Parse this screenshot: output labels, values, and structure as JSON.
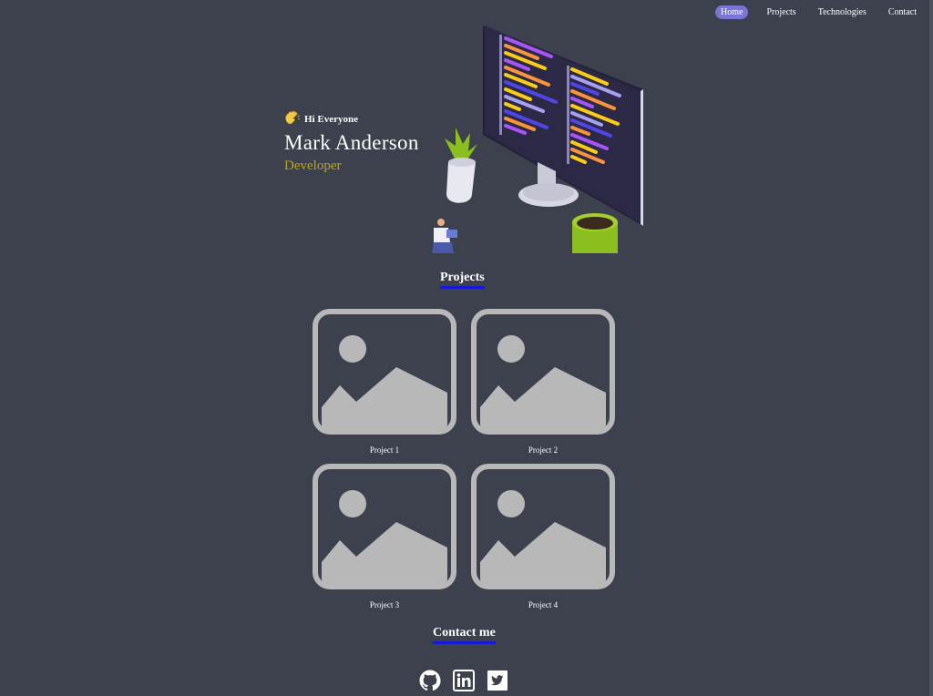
{
  "nav": {
    "items": [
      {
        "label": "Home",
        "active": true
      },
      {
        "label": "Projects",
        "active": false
      },
      {
        "label": "Technologies",
        "active": false
      },
      {
        "label": "Contact",
        "active": false
      }
    ]
  },
  "hero": {
    "greeting_icon": "waving-hand-icon",
    "greeting": "Hi Everyone",
    "name": "Mark Anderson",
    "role": "Developer"
  },
  "projects": {
    "title": "Projects",
    "items": [
      {
        "label": "Project 1",
        "icon": "image-placeholder-icon"
      },
      {
        "label": "Project 2",
        "icon": "image-placeholder-icon"
      },
      {
        "label": "Project 3",
        "icon": "image-placeholder-icon"
      },
      {
        "label": "Project 4",
        "icon": "image-placeholder-icon"
      }
    ]
  },
  "contact": {
    "title": "Contact me",
    "socials": [
      {
        "icon": "github-icon"
      },
      {
        "icon": "linkedin-icon"
      },
      {
        "icon": "twitter-icon"
      }
    ]
  },
  "colors": {
    "background": "#3d404d",
    "accent": "#7b76d6",
    "role": "#b8a81d",
    "underline": "#1818d8",
    "placeholder": "#b8b8b8"
  }
}
